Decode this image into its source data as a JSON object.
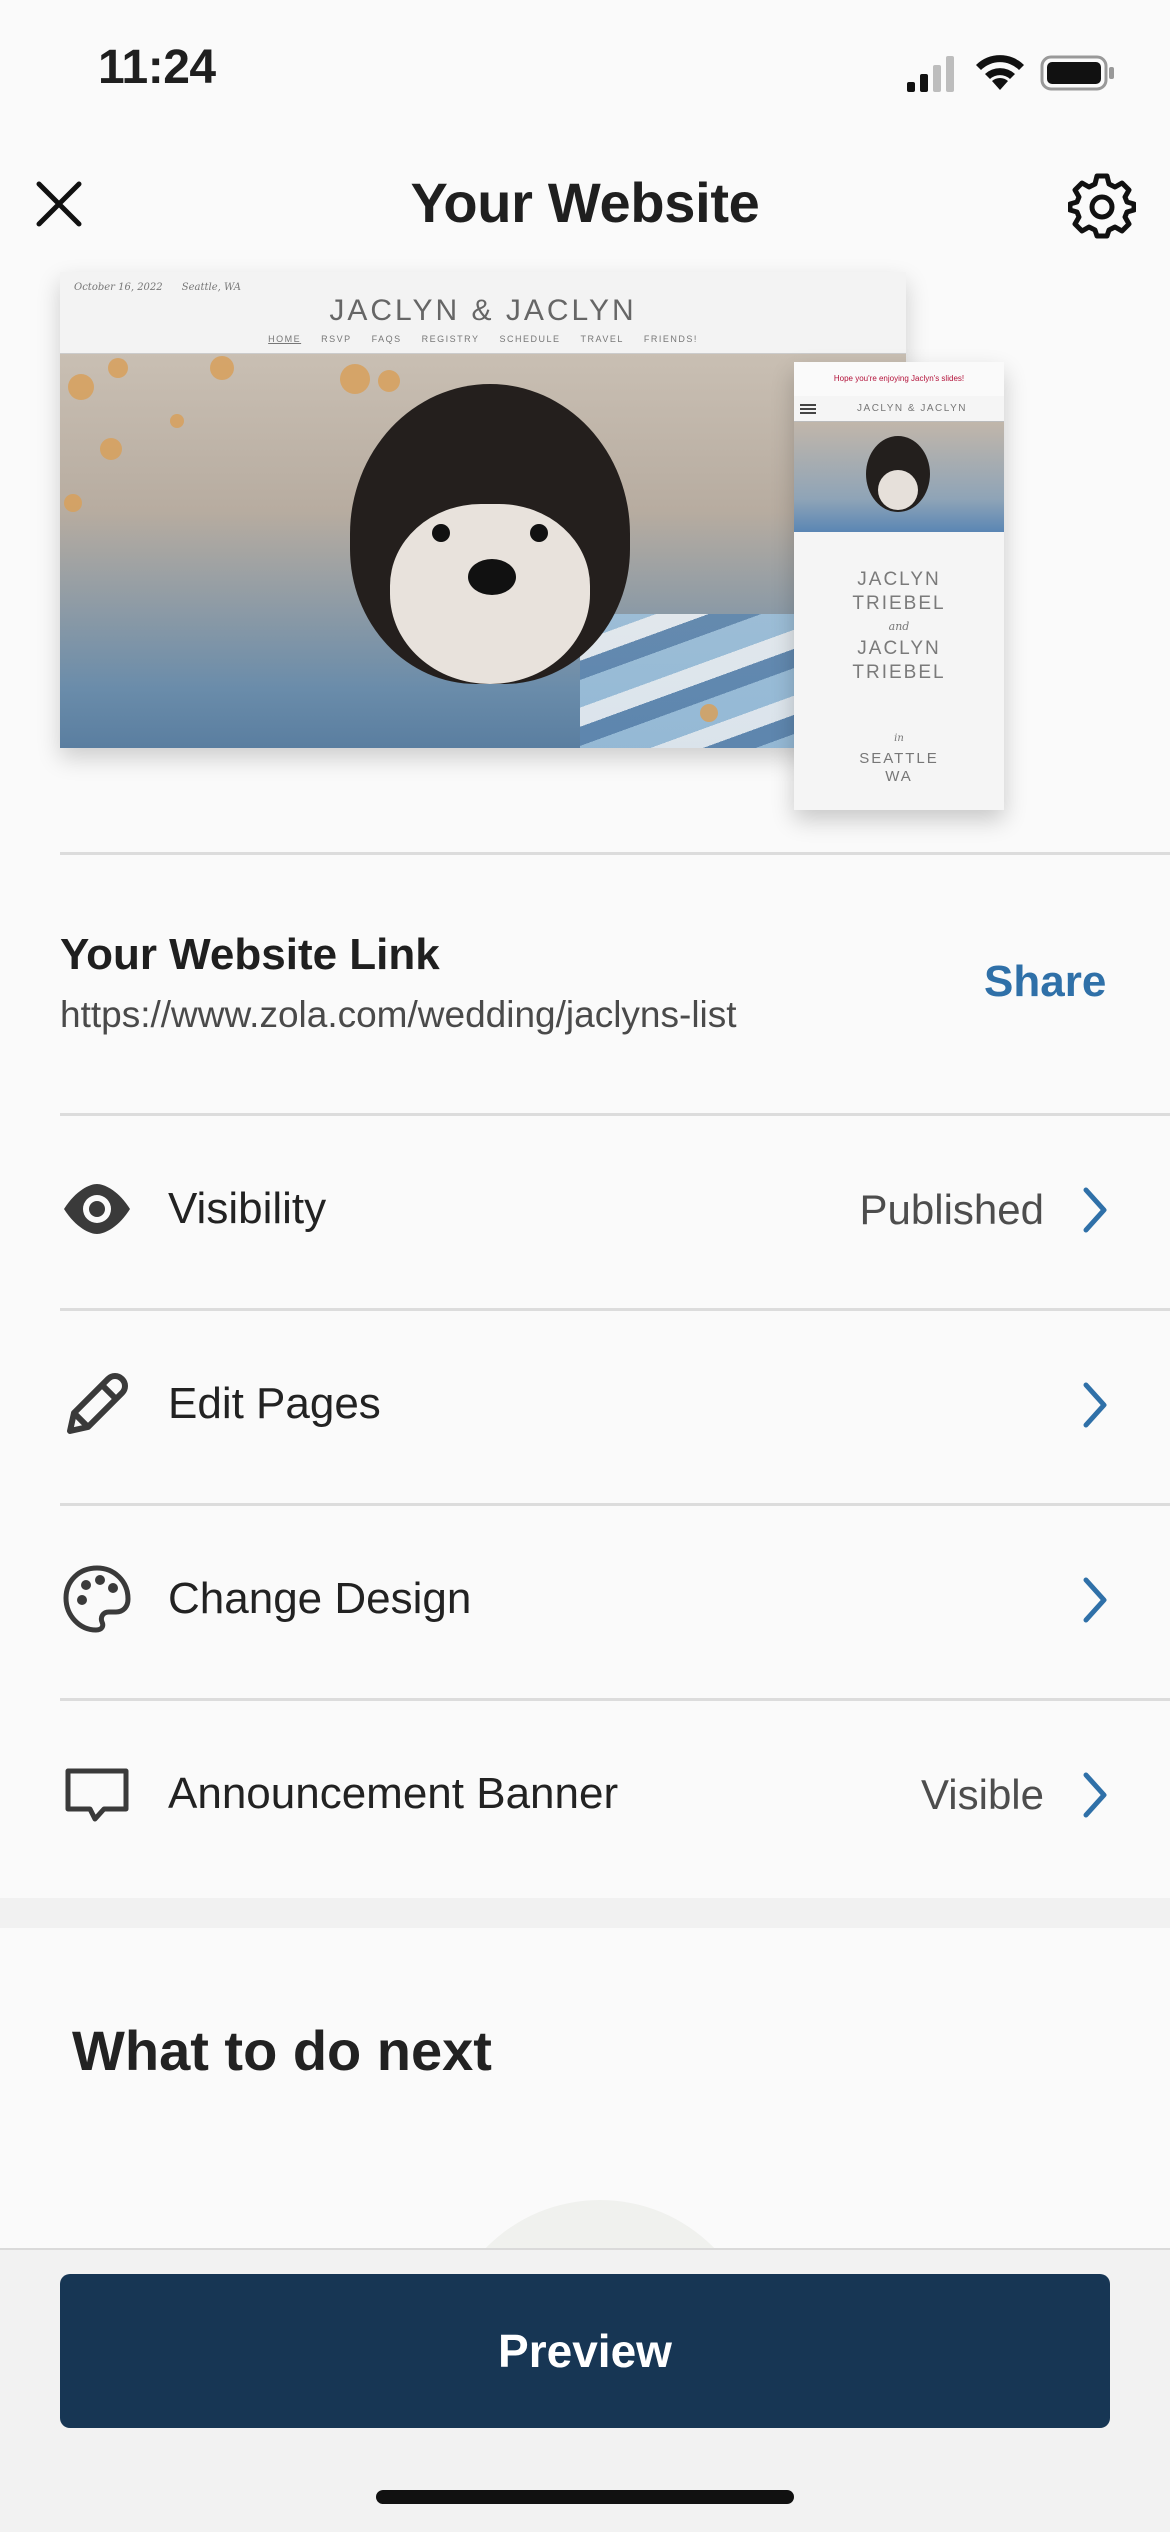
{
  "status_bar": {
    "time": "11:24"
  },
  "header": {
    "title": "Your Website"
  },
  "preview": {
    "desktop": {
      "date": "October 16, 2022",
      "location": "Seattle, WA",
      "names": "JACLYN & JACLYN",
      "nav": [
        "HOME",
        "RSVP",
        "FAQS",
        "REGISTRY",
        "SCHEDULE",
        "TRAVEL",
        "FRIENDS!"
      ]
    },
    "mobile": {
      "banner": "Hope you're enjoying Jaclyn's slides!",
      "title": "JACLYN & JACLYN",
      "name1_first": "JACLYN",
      "name1_last": "TRIEBEL",
      "and": "and",
      "name2_first": "JACLYN",
      "name2_last": "TRIEBEL",
      "in": "in",
      "city": "SEATTLE",
      "state": "WA"
    }
  },
  "website_link": {
    "title": "Your Website Link",
    "url": "https://www.zola.com/wedding/jaclyns-list",
    "share_label": "Share"
  },
  "menu": [
    {
      "label": "Visibility",
      "value": "Published",
      "icon": "eye-icon"
    },
    {
      "label": "Edit Pages",
      "value": "",
      "icon": "pencil-icon"
    },
    {
      "label": "Change Design",
      "value": "",
      "icon": "palette-icon"
    },
    {
      "label": "Announcement Banner",
      "value": "Visible",
      "icon": "message-icon"
    }
  ],
  "next_section": {
    "title": "What to do next"
  },
  "preview_button": {
    "label": "Preview"
  },
  "colors": {
    "accent": "#2f70a8",
    "button": "#173654",
    "banner_text": "#b3123a"
  }
}
